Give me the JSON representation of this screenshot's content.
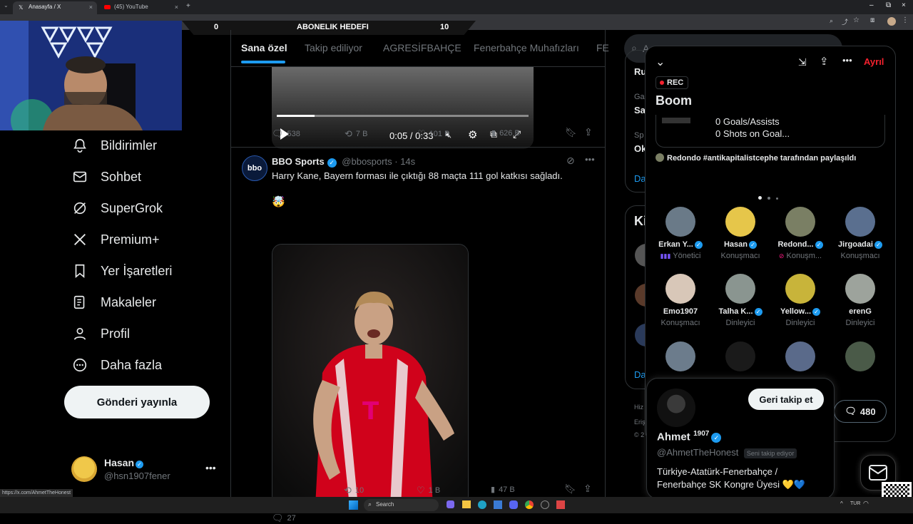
{
  "browser": {
    "tabs": [
      {
        "title": "Anasayfa / X",
        "favicon": "x-logo-icon",
        "active": true
      },
      {
        "title": "(45) YouTube",
        "favicon": "youtube-icon",
        "active": false
      }
    ],
    "status_url": "https://x.com/AhmetTheHonest"
  },
  "overlay": {
    "goal_left": "0",
    "goal_title": "ABONELIK HEDEFI",
    "goal_right": "10"
  },
  "nav": {
    "items": [
      {
        "label": "Bildirimler",
        "icon": "bell-icon"
      },
      {
        "label": "Sohbet",
        "icon": "mail-icon"
      },
      {
        "label": "SuperGrok",
        "icon": "grok-icon"
      },
      {
        "label": "Premium+",
        "icon": "x-logo-icon"
      },
      {
        "label": "Yer İşaretleri",
        "icon": "bookmark-icon"
      },
      {
        "label": "Makaleler",
        "icon": "article-icon"
      },
      {
        "label": "Profil",
        "icon": "person-icon"
      },
      {
        "label": "Daha fazla",
        "icon": "more-circle-icon"
      }
    ],
    "post_button": "Gönderi yayınla",
    "account": {
      "name": "Hasan",
      "handle": "@hsn1907fener"
    }
  },
  "timeline": {
    "tabs": [
      "Sana özel",
      "Takip ediliyor",
      "AGRESİFBAHÇE",
      "Fenerbahçe Muhafızları",
      "FE"
    ],
    "video": {
      "time": "0:05 / 0:33",
      "progress": 0.15
    },
    "tweet1_actions": {
      "replies": "538",
      "reposts": "7 B",
      "likes": "101 B",
      "views": "626 B"
    },
    "tweet2": {
      "author": "BBO Sports",
      "handle": "@bbosports",
      "time": "14s",
      "avatar_text": "bbo",
      "text": "Harry Kane, Bayern forması ile çıktığı 88 maçta 111 gol katkısı sağladı.",
      "emoji": "🤯",
      "actions": {
        "replies": "27",
        "reposts": "10",
        "likes": "1 B",
        "views": "47 B"
      }
    }
  },
  "right_rail": {
    "search_placeholder": "A",
    "snippets": [
      "Ru",
      "Ga",
      "Sa",
      "Sp",
      "Ok",
      "Da",
      "Ki",
      "Da",
      "Hiz",
      "Eriş",
      "© 2"
    ]
  },
  "space": {
    "rec": "REC",
    "title": "Boom",
    "leave": "Ayrıl",
    "card_line1": "0 Goals/Assists",
    "card_line2": "0 Shots on Goal...",
    "shared_by": "Redondo #antikapitalistcephe tarafından paylaşıldı",
    "participants": [
      {
        "name": "Erkan Y...",
        "role": "Yönetici",
        "verified": true,
        "color": "#6a7a88"
      },
      {
        "name": "Hasan",
        "role": "Konuşmacı",
        "verified": true,
        "color": "#e6c64a"
      },
      {
        "name": "Redond...",
        "role": "Konuşm...",
        "verified": true,
        "color": "#7a7f64"
      },
      {
        "name": "Jirgoadai",
        "role": "Konuşmacı",
        "verified": true,
        "color": "#5a6f8f"
      },
      {
        "name": "Emo1907",
        "role": "Konuşmacı",
        "verified": false,
        "color": "#d8c7b8"
      },
      {
        "name": "Talha K...",
        "role": "Dinleyici",
        "verified": true,
        "color": "#8a9590"
      },
      {
        "name": "Yellow...",
        "role": "Dinleyici",
        "verified": true,
        "color": "#c8b43a"
      },
      {
        "name": "erenG",
        "role": "Dinleyici",
        "verified": false,
        "color": "#9da39c"
      }
    ],
    "comments_count": "480"
  },
  "profile_card": {
    "name": "Ahmet",
    "superscript": "1907",
    "handle": "@AhmetTheHonest",
    "follows_you": "Seni takip ediyor",
    "follow_back": "Geri takip et",
    "bio": "Türkiye-Atatürk-Fenerbahçe / Fenerbahçe SK Kongre Üyesi 💛💙"
  },
  "taskbar": {
    "search": "Search",
    "lang": "TUR"
  },
  "colors": {
    "accent": "#1d9bf0",
    "leave": "#f4212e",
    "bg": "#000000"
  }
}
